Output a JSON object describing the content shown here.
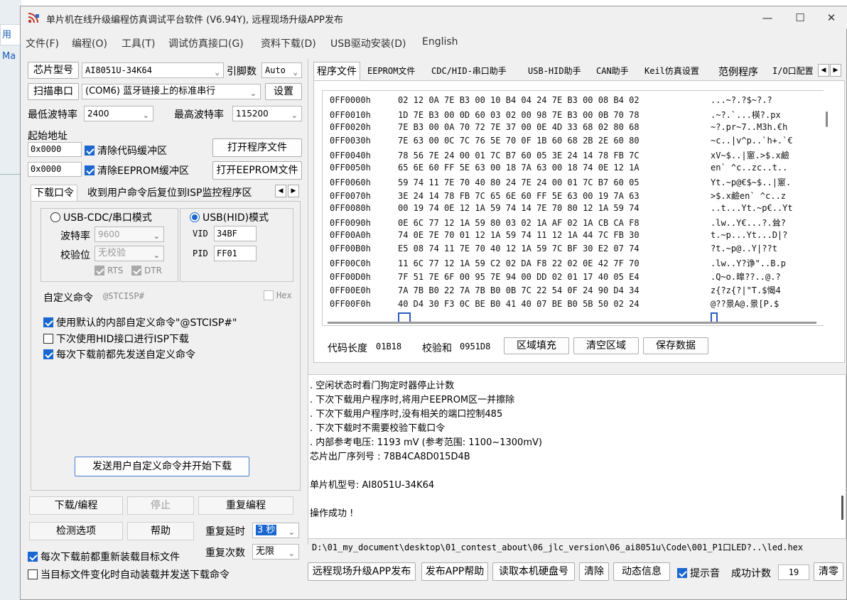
{
  "background": {
    "left_tab_fragment": "用Ma"
  },
  "window": {
    "title": "单片机在线升级编程仿真调试平台软件 (V6.94Y), 远程现场升级APP发布",
    "controls": {
      "minimize": "—",
      "maximize": "☐",
      "close": "✕"
    }
  },
  "menu": [
    "文件(F)",
    "编程(O)",
    "工具(T)",
    "调试仿真接口(G)",
    "资料下载(D)",
    "USB驱动安装(D)",
    "English"
  ],
  "left": {
    "chip_model_label": "芯片型号",
    "chip_model_value": "AI8051U-34K64",
    "pin_count_label": "引脚数",
    "pin_count_value": "Auto",
    "scan_port_button": "扫描串口",
    "port_value": "(COM6) 蓝牙链接上的标准串行",
    "settings_button": "设置",
    "min_baud_label": "最低波特率",
    "min_baud_value": "2400",
    "max_baud_label": "最高波特率",
    "max_baud_value": "115200",
    "start_addr_label": "起始地址",
    "code_addr_value": "0x0000",
    "clear_code_buffer": "清除代码缓冲区",
    "open_program_button": "打开程序文件",
    "eeprom_addr_value": "0x0000",
    "clear_eeprom_buffer": "清除EEPROM缓冲区",
    "open_eeprom_button": "打开EEPROM文件",
    "subtab_download": "下载口令",
    "subtab_reset": "收到用户命令后复位到ISP监控程序区",
    "usb_cdc_mode": "USB-CDC/串口模式",
    "usb_hid_mode": "USB(HID)模式",
    "baud_label": "波特率",
    "baud_value": "9600",
    "parity_label": "校验位",
    "parity_value": "无校验",
    "rts_label": "RTS",
    "dtr_label": "DTR",
    "vid_label": "VID",
    "vid_value": "34BF",
    "pid_label": "PID",
    "pid_value": "FF01",
    "custom_cmd_label": "自定义命令",
    "custom_cmd_value": "@STCISP#",
    "hex_label": "Hex",
    "opt_default_cmd": "使用默认的内部自定义命令\"@STCISP#\"",
    "opt_hid_next": "下次使用HID接口进行ISP下载",
    "opt_send_before": "每次下载前都先发送自定义命令",
    "send_and_download_button": "发送用户自定义命令并开始下载",
    "download_button": "下载/编程",
    "stop_button": "停止",
    "reprogram_button": "重复编程",
    "check_options_button": "检测选项",
    "help_button": "帮助",
    "repeat_delay_label": "重复延时",
    "repeat_delay_value": "3 秒",
    "repeat_count_label": "重复次数",
    "repeat_count_value": "无限",
    "reload_each_time": "每次下载前都重新装载目标文件",
    "auto_reload": "当目标文件变化时自动装载并发送下载命令"
  },
  "tabs": [
    "程序文件",
    "EEPROM文件",
    "CDC/HID-串口助手",
    "USB-HID助手",
    "CAN助手",
    "Keil仿真设置",
    "范例程序",
    "I/O口配置"
  ],
  "hex_rows": [
    {
      "addr": "0FF0000h",
      "bytes": "02 12 0A 7E B3 00 10 B4 04 24 7E B3 00 08 B4 02",
      "ascii": "...~?.?$~?.?"
    },
    {
      "addr": "0FF0010h",
      "bytes": "1D 7E B3 00 0D 60 03 02 00 98 7E B3 00 0B 70 78",
      "ascii": ".~?.`...楧?.px"
    },
    {
      "addr": "0FF0020h",
      "bytes": "7E B3 00 0A 70 72 7E 37 00 0E 4D 33 68 02 80 68",
      "ascii": "~?.pr~7..M3h.€h"
    },
    {
      "addr": "0FF0030h",
      "bytes": "7E 63 00 0C 7C 76 5E 70 0F 1B 60 68 2B 2E 60 80",
      "ascii": "~c..|v^p..`h+.`€"
    },
    {
      "addr": "0FF0040h",
      "bytes": "78 56 7E 24 00 01 7C B7 60 05 3E 24 14 78 FB 7C",
      "ascii": "xV~$..|窻.>$.x鹼"
    },
    {
      "addr": "0FF0050h",
      "bytes": "65 6E 60 FF 5E 63 00 18 7A 63 00 18 74 0E 12 1A",
      "ascii": "en`  ^c..zc..t.."
    },
    {
      "addr": "0FF0060h",
      "bytes": "59 74 11 7E 70 40 80 24 7E 24 00 01 7C B7 60 05",
      "ascii": "Yt.~p@€$~$..|窻."
    },
    {
      "addr": "0FF0070h",
      "bytes": "3E 24 14 78 FB 7C 65 6E 60 FF 5E 63 00 19 7A 63",
      "ascii": ">$.x鹼en`  ^c..z"
    },
    {
      "addr": "0FF0080h",
      "bytes": "00 19 74 0E 12 1A 59 74 14 7E 70 80 12 1A 59 74",
      "ascii": "..t...Yt.~p€..Yt"
    },
    {
      "addr": "0FF0090h",
      "bytes": "0E 6C 77 12 1A 59 80 03 02 1A AF 02 1A CB CA F8",
      "ascii": ".lw..Y€...?.耸?"
    },
    {
      "addr": "0FF00A0h",
      "bytes": "74 0E 7E 70 01 12 1A 59 74 11 12 1A 44 7C FB 30",
      "ascii": "t.~p...Yt...D|?"
    },
    {
      "addr": "0FF00B0h",
      "bytes": "E5 08 74 11 7E 70 40 12 1A 59 7C BF 30 E2 07 74",
      "ascii": "?t.~p@..Y|??t"
    },
    {
      "addr": "0FF00C0h",
      "bytes": "11 6C 77 12 1A 59 C2 02 DA F8 22 02 0E 42 7F 70",
      "ascii": ".lw..Y?诤\"..B.p"
    },
    {
      "addr": "0FF00D0h",
      "bytes": "7F 51 7E 6F 00 95 7E 94 00 DD 02 01 17 40 05 E4",
      "ascii": ".Q~o.曍??..@.?"
    },
    {
      "addr": "0FF00E0h",
      "bytes": "7A 7B B0 22 7A 7B B0 0B 7C 22 54 0F 24 90 D4 34",
      "ascii": "z{?z{?|\"T.$愒4"
    },
    {
      "addr": "0FF00F0h",
      "bytes": "40 D4 30 F3 0C BE B0 41 40 07 BE B0 5B 50 02 24",
      "ascii": "@??景A@.景[P.$"
    }
  ],
  "code_info": {
    "code_length_label": "代码长度",
    "code_length_value": "01B18",
    "checksum_label": "校验和",
    "checksum_value": "0951D8",
    "fill_button": "区域填充",
    "clear_button": "清空区域",
    "save_button": "保存数据"
  },
  "log": [
    "  . 空闲状态时看门狗定时器停止计数",
    "  . 下次下载用户程序时,将用户EEPROM区一并擦除",
    "  . 下次下载用户程序时,没有相关的端口控制485",
    "  . 下次下载时不需要校验下载口令",
    "  . 内部参考电压: 1193 mV (参考范围: 1100~1300mV)",
    "芯片出厂序列号 : 78B4CA8D015D4B",
    "",
    "  单片机型号: AI8051U-34K64",
    "",
    "操作成功 !"
  ],
  "path": "D:\\01_my_document\\desktop\\01_contest_about\\06_jlc_version\\06_ai8051u\\Code\\001_P1口LED?..\\led.hex",
  "bottom": {
    "remote_upgrade_button": "远程现场升级APP发布",
    "publish_help_button": "发布APP帮助",
    "read_disk_button": "读取本机硬盘号",
    "clear_button": "清除",
    "dynamic_info_button": "动态信息",
    "beep_label": "提示音",
    "success_count_label": "成功计数",
    "success_count_value": "19",
    "reset_button": "清零"
  },
  "colors": {
    "accent": "#1a67d0",
    "title_icon": "#c0392b"
  }
}
